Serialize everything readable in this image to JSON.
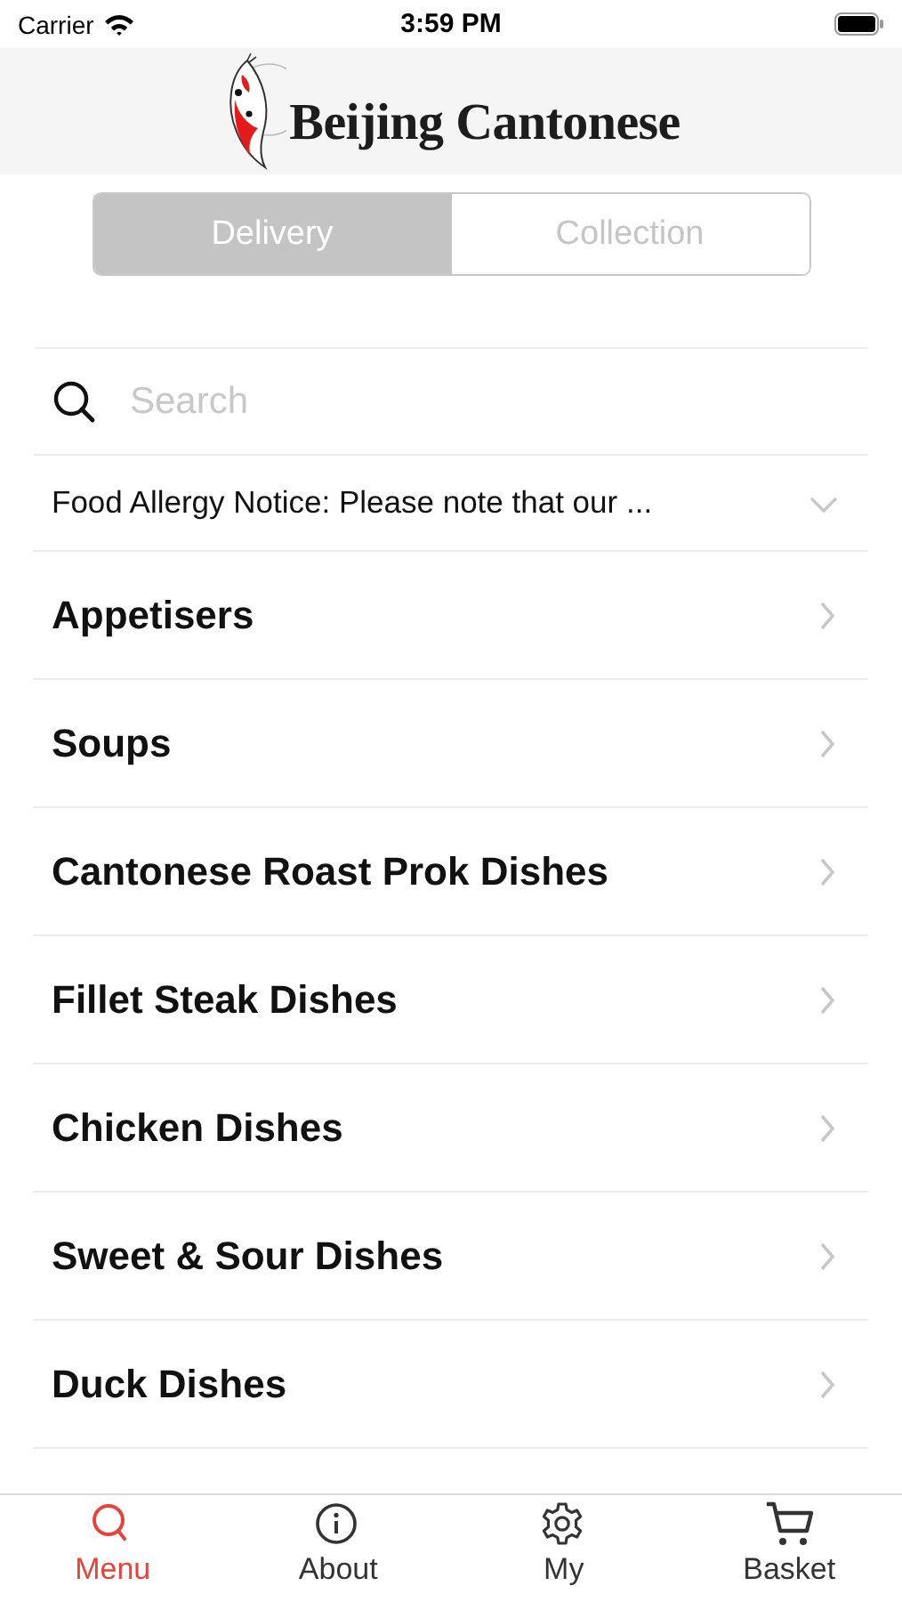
{
  "status_bar": {
    "carrier": "Carrier",
    "time": "3:59 PM"
  },
  "header": {
    "logo_text": "Beijing Cantonese"
  },
  "order_type": [
    {
      "label": "Delivery",
      "selected": true
    },
    {
      "label": "Collection",
      "selected": false
    }
  ],
  "search": {
    "placeholder": "Search"
  },
  "notice": {
    "text": "Food Allergy Notice: Please note that our ...",
    "expanded": false
  },
  "categories": [
    {
      "name": "Appetisers"
    },
    {
      "name": "Soups"
    },
    {
      "name": "Cantonese Roast Prok Dishes"
    },
    {
      "name": "Fillet Steak Dishes"
    },
    {
      "name": "Chicken Dishes"
    },
    {
      "name": "Sweet & Sour Dishes"
    },
    {
      "name": "Duck Dishes"
    }
  ],
  "tab_bar": [
    {
      "kind": "search",
      "label": "Menu",
      "selected": true
    },
    {
      "kind": "info",
      "label": "About",
      "selected": false
    },
    {
      "kind": "gear",
      "label": "My",
      "selected": false
    },
    {
      "kind": "cart",
      "label": "Basket",
      "selected": false
    }
  ]
}
